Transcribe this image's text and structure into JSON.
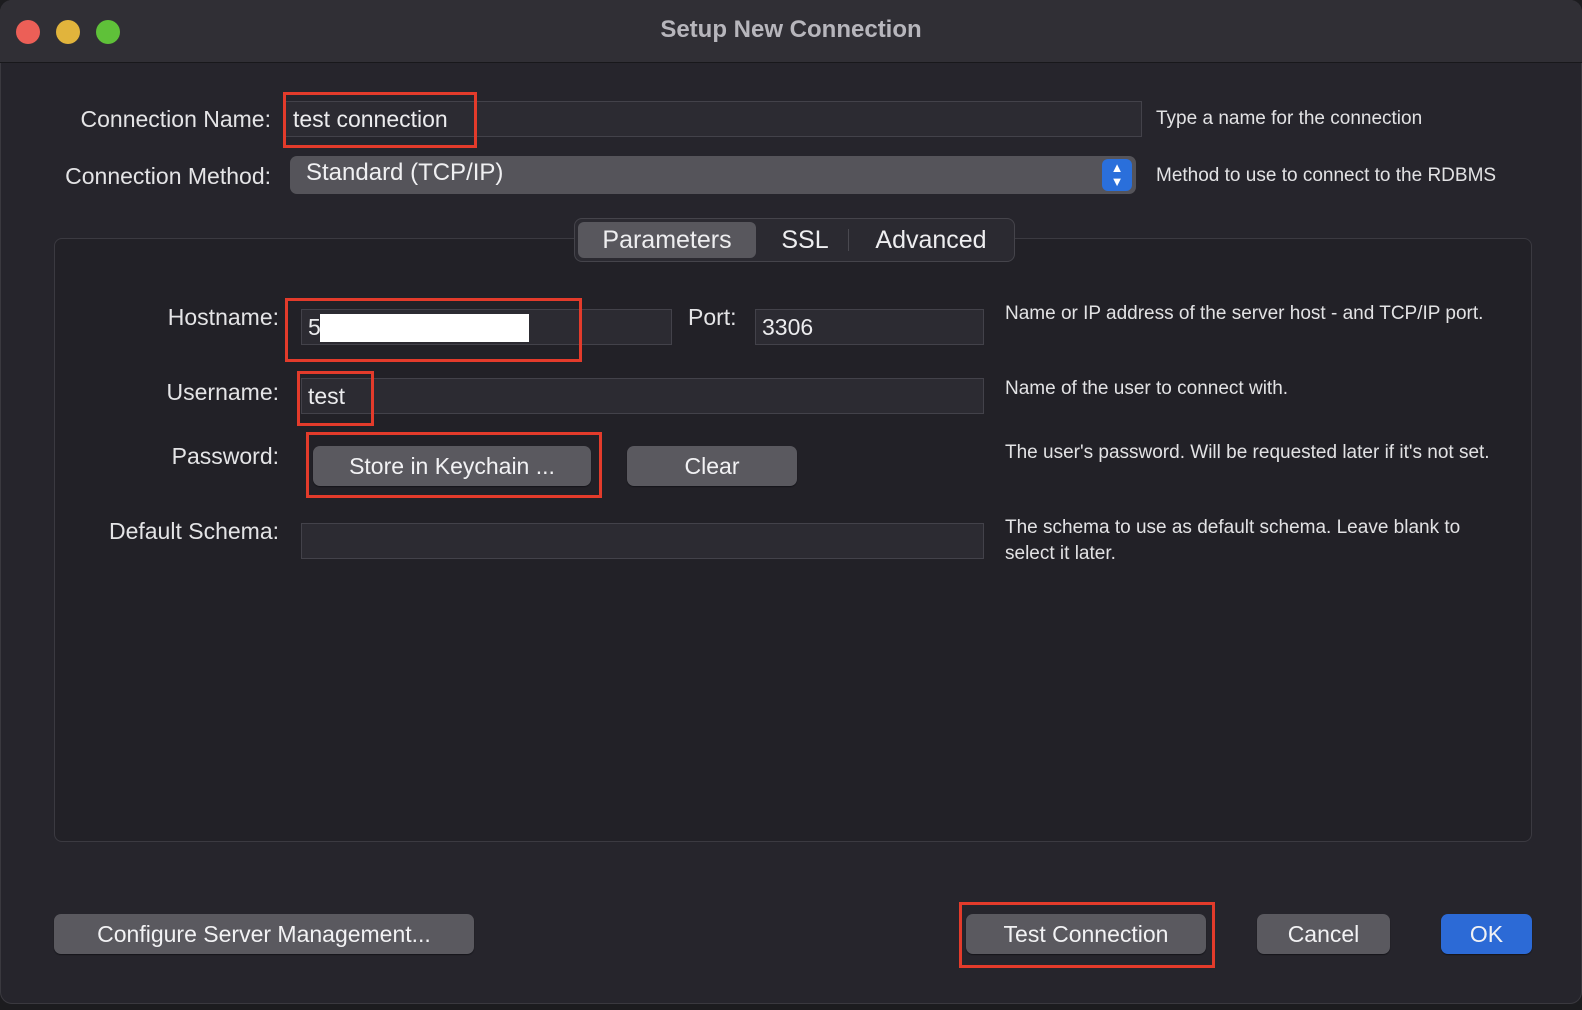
{
  "window": {
    "title": "Setup New Connection"
  },
  "form": {
    "connection_name_label": "Connection Name:",
    "connection_name_value": "test connection",
    "connection_name_hint": "Type a name for the connection",
    "connection_method_label": "Connection Method:",
    "connection_method_value": "Standard (TCP/IP)",
    "connection_method_hint": "Method to use to connect to the RDBMS"
  },
  "tabs": [
    {
      "label": "Parameters",
      "active": true
    },
    {
      "label": "SSL",
      "active": false
    },
    {
      "label": "Advanced",
      "active": false
    }
  ],
  "parameters": {
    "hostname_label": "Hostname:",
    "hostname_value": "5",
    "port_label": "Port:",
    "port_value": "3306",
    "hostname_hint": "Name or IP address of the server host - and TCP/IP port.",
    "username_label": "Username:",
    "username_value": "test",
    "username_hint": "Name of the user to connect with.",
    "password_label": "Password:",
    "store_keychain_label": "Store in Keychain ...",
    "clear_label": "Clear",
    "password_hint": "The user's password. Will be requested later if it's not set.",
    "default_schema_label": "Default Schema:",
    "default_schema_value": "",
    "default_schema_hint": "The schema to use as default schema. Leave blank to select it later."
  },
  "footer": {
    "configure_label": "Configure Server Management...",
    "test_label": "Test Connection",
    "cancel_label": "Cancel",
    "ok_label": "OK"
  },
  "colors": {
    "highlight": "#e33b2b",
    "accent": "#2c6ad6",
    "window_bg": "#26252c"
  }
}
